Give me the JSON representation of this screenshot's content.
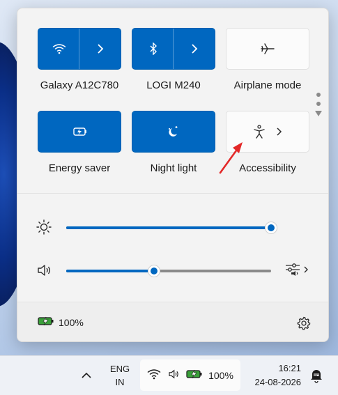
{
  "quick_settings": {
    "tiles": [
      {
        "label": "Galaxy A12C780",
        "state": "on",
        "icon": "wifi-icon",
        "has_chevron": true
      },
      {
        "label": "LOGI M240",
        "state": "on",
        "icon": "bluetooth-icon",
        "has_chevron": true
      },
      {
        "label": "Airplane mode",
        "state": "off",
        "icon": "airplane-icon",
        "has_chevron": false
      },
      {
        "label": "Energy saver",
        "state": "on",
        "icon": "energy-saver-icon",
        "has_chevron": false
      },
      {
        "label": "Night light",
        "state": "on",
        "icon": "night-light-icon",
        "has_chevron": false
      },
      {
        "label": "Accessibility",
        "state": "off",
        "icon": "accessibility-icon",
        "has_chevron": true
      }
    ],
    "page_indicator": {
      "pages": 2,
      "current": 1
    }
  },
  "sliders": {
    "brightness": {
      "icon": "brightness-icon",
      "value": 100
    },
    "volume": {
      "icon": "speaker-icon",
      "value": 43
    }
  },
  "footer": {
    "battery_percent": "100%",
    "battery_icon": "battery-charging-icon",
    "settings_icon": "gear-icon"
  },
  "taskbar": {
    "lang_line1": "ENG",
    "lang_line2": "IN",
    "tray_battery": "100%",
    "time": "16:21",
    "date": "24-08-2026"
  },
  "colors": {
    "accent": "#0067c0",
    "tile_off": "#fbfbfb",
    "panel_bg": "#f3f3f3",
    "annotation_arrow": "#e32828"
  }
}
